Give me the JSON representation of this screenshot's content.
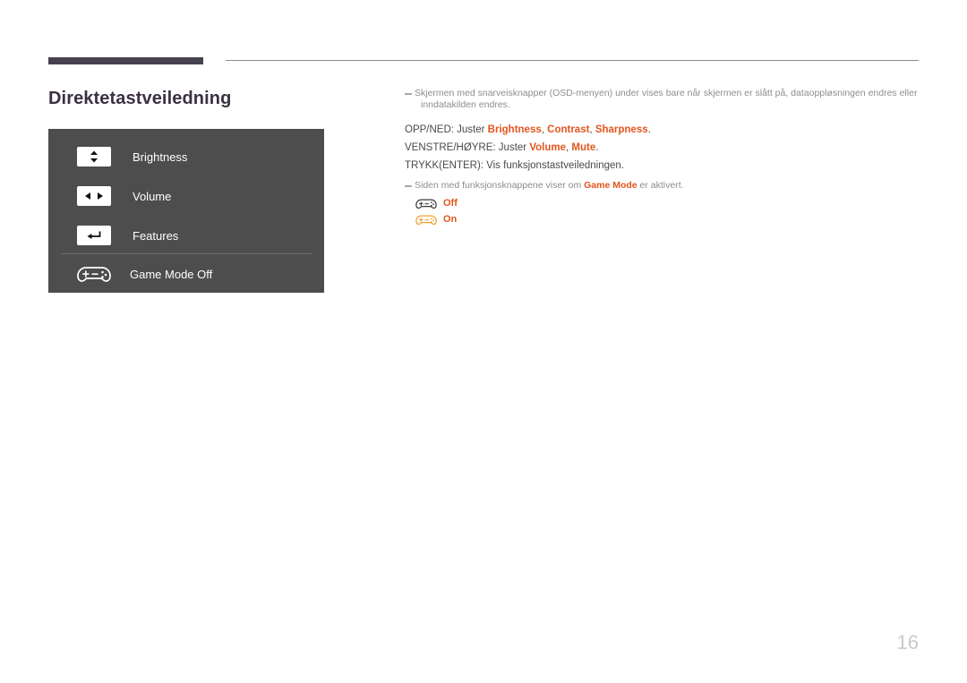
{
  "document": {
    "title": "Direktetastveiledning",
    "page_number": "16",
    "accent_color": "#e2551e",
    "title_color": "#3c3143",
    "rule_color": "#46414f",
    "panel_color": "#4d4d4d"
  },
  "osd_panel": {
    "rows": [
      {
        "icon": "up-down-arrows-icon",
        "label": "Brightness"
      },
      {
        "icon": "left-right-arrows-icon",
        "label": "Volume"
      },
      {
        "icon": "enter-return-arrow-icon",
        "label": "Features"
      },
      {
        "icon": "gamepad-icon",
        "label": "Game Mode Off"
      }
    ]
  },
  "body": {
    "note_1": {
      "text": "Skjermen med snarveisknapper (OSD-menyen) under vises bare når skjermen er slått på, dataoppløsningen endres eller",
      "text_line2": "inndatakilden endres."
    },
    "instructions": [
      {
        "prefix": "OPP/NED: Juster ",
        "parts": [
          {
            "text": "Brightness",
            "accent": true
          },
          {
            "text": ", ",
            "accent": false
          },
          {
            "text": "Contrast",
            "accent": true
          },
          {
            "text": ", ",
            "accent": false
          },
          {
            "text": "Sharpness",
            "accent": true
          },
          {
            "text": ".",
            "accent": false
          }
        ]
      },
      {
        "prefix": "VENSTRE/HØYRE: Juster ",
        "parts": [
          {
            "text": "Volume",
            "accent": true
          },
          {
            "text": ", ",
            "accent": false
          },
          {
            "text": "Mute",
            "accent": true
          },
          {
            "text": ".",
            "accent": false
          }
        ]
      },
      {
        "prefix": "TRYKK(ENTER): Vis funksjonstastveiledningen.",
        "parts": []
      }
    ],
    "note_2": {
      "prefix": "Siden med funksjonsknappene viser om ",
      "accent": "Game Mode",
      "suffix": " er aktivert."
    },
    "legend": [
      {
        "icon": "gamepad-off-icon",
        "label": "Off",
        "color": "#3b3b3b"
      },
      {
        "icon": "gamepad-on-icon",
        "label": "On",
        "color": "#f0a030"
      }
    ]
  }
}
